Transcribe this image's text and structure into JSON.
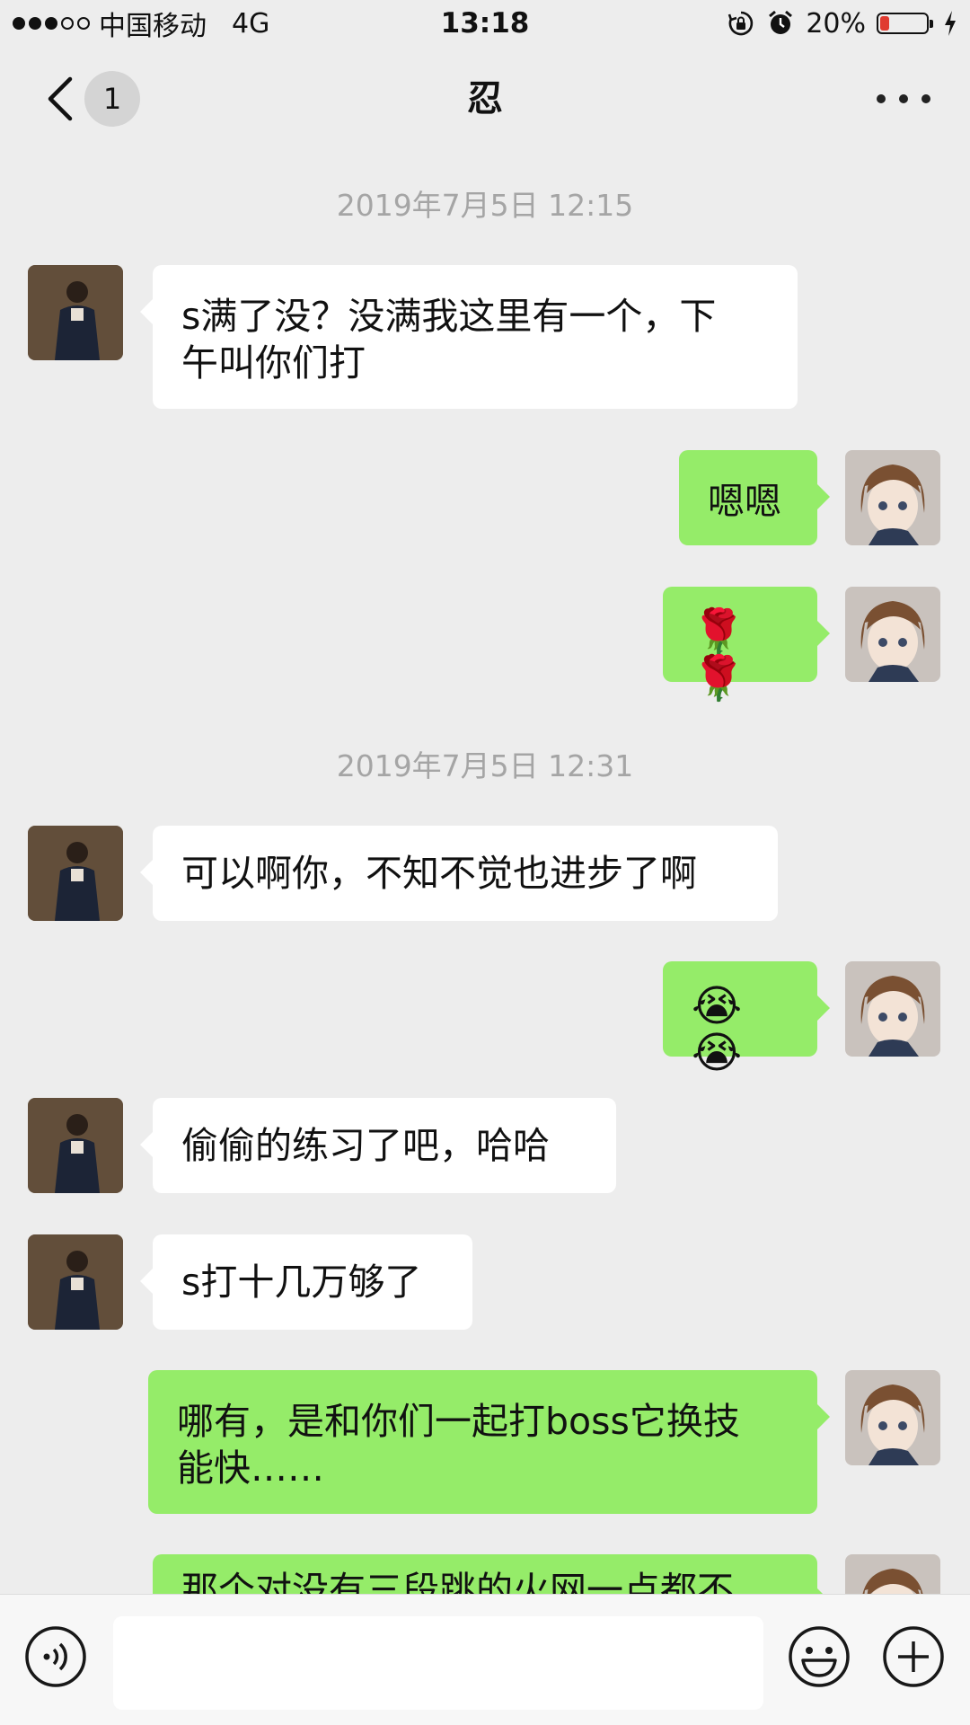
{
  "status_bar": {
    "carrier": "中国移动",
    "network": "4G",
    "time": "13:18",
    "battery_percent_text": "20%",
    "battery_level": 0.2,
    "battery_color": "#e03b30",
    "icons": [
      "rotation-lock-icon",
      "alarm-icon",
      "charging-bolt-icon"
    ]
  },
  "nav": {
    "back_icon": "chevron-left-icon",
    "unread_count": "1",
    "title": "忍",
    "more_icon": "ellipsis-icon"
  },
  "chat": {
    "timestamps": [
      "2019年7月5日 12:15",
      "2019年7月5日 12:31"
    ],
    "messages": [
      {
        "side": "in",
        "text_lines": [
          "s满了没？没满我这里有一个，下",
          "午叫你们打"
        ]
      },
      {
        "side": "out",
        "text": "嗯嗯"
      },
      {
        "side": "out",
        "text": "🌹 🌹"
      },
      {
        "side": "in",
        "text": "可以啊你，不知不觉也进步了啊"
      },
      {
        "side": "out",
        "text": "😭😭"
      },
      {
        "side": "in",
        "text": "偷偷的练习了吧，哈哈"
      },
      {
        "side": "in",
        "text": "s打十几万够了"
      },
      {
        "side": "out",
        "text_lines": [
          "哪有，是和你们一起打boss它换技",
          "能快……"
        ]
      },
      {
        "side": "out",
        "text": "那个对没有三段跳的火网一点都不"
      }
    ]
  },
  "colors": {
    "background": "#ededed",
    "incoming_bubble": "#ffffff",
    "outgoing_bubble": "#95ec69",
    "timestamp_text": "#a5a5a5"
  },
  "input_bar": {
    "voice_icon": "voice-icon",
    "text_value": "",
    "emoji_icon": "emoji-icon",
    "plus_icon": "plus-icon"
  }
}
